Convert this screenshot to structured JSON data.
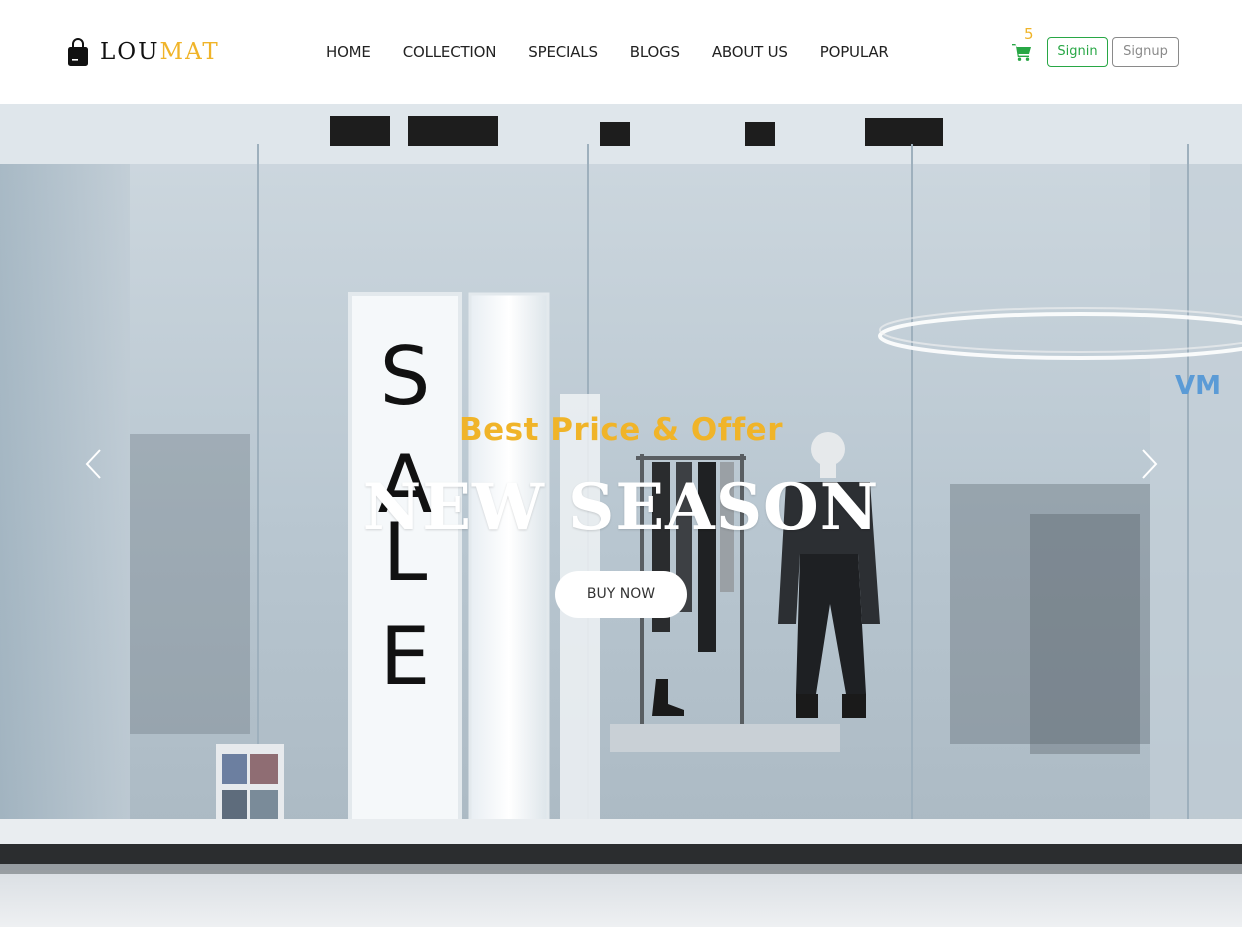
{
  "brand": {
    "name_part_a": "LOU",
    "name_part_b": "MAT",
    "icon": "shopping-bag-icon",
    "colors": {
      "dark": "#111111",
      "accent": "#f0b429"
    }
  },
  "nav": {
    "items": [
      {
        "label": "HOME"
      },
      {
        "label": "COLLECTION"
      },
      {
        "label": "SPECIALS"
      },
      {
        "label": "BLOGS"
      },
      {
        "label": "ABOUT US"
      },
      {
        "label": "POPULAR"
      }
    ]
  },
  "cart": {
    "count": "5",
    "icon": "shopping-cart-icon"
  },
  "auth": {
    "signin_label": "Signin",
    "signup_label": "Signup",
    "signin_color": "#28a745",
    "signup_color": "#8a8a8a"
  },
  "hero": {
    "subtitle": "Best Price & Offer",
    "title": "NEW SEASON",
    "cta_label": "BUY NOW",
    "background": "store-window-photo",
    "prev_icon": "chevron-left-icon",
    "next_icon": "chevron-right-icon",
    "subtitle_color": "#f0b429"
  }
}
